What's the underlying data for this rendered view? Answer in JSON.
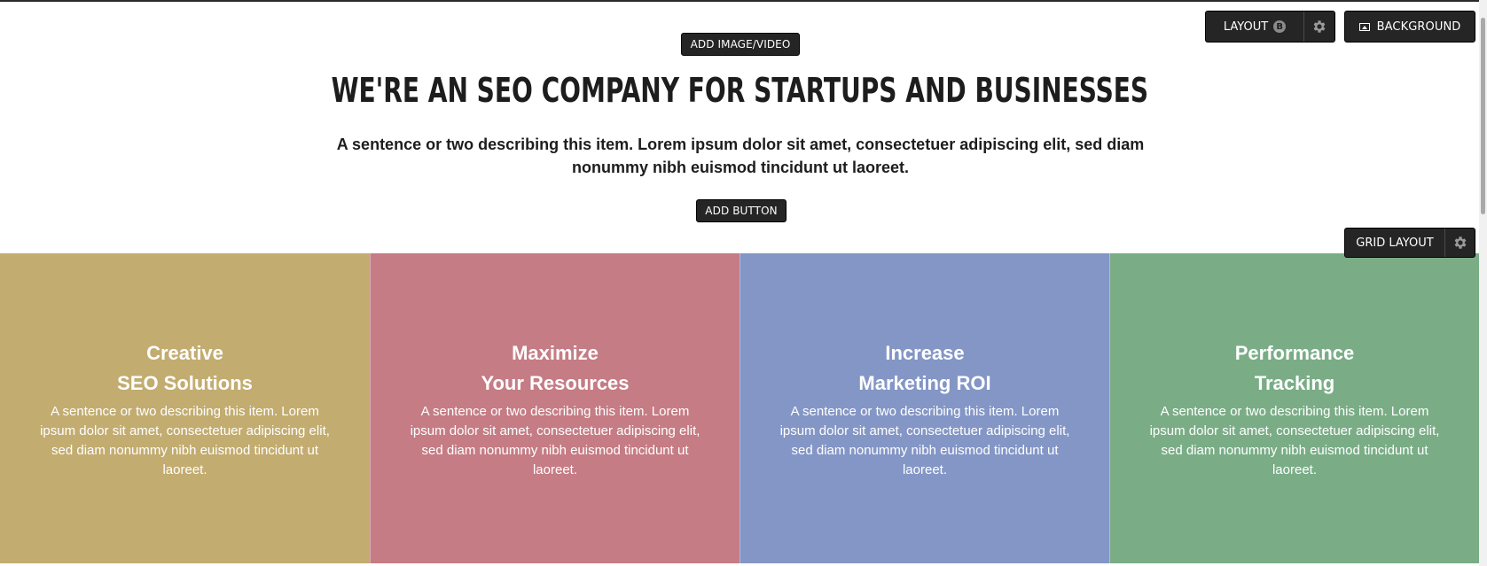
{
  "toolbar": {
    "add_media_label": "ADD IMAGE/VIDEO",
    "add_button_label": "ADD BUTTON",
    "layout_label": "LAYOUT",
    "layout_badge": "B",
    "background_label": "BACKGROUND",
    "grid_layout_label": "GRID LAYOUT"
  },
  "hero": {
    "title": "WE'RE AN SEO COMPANY FOR STARTUPS AND BUSINESSES",
    "subtitle": "A sentence or two describing this item. Lorem ipsum dolor sit amet, consectetuer adipiscing elit, sed diam nonummy nibh euismod tincidunt ut laoreet."
  },
  "features": [
    {
      "title_line1": "Creative",
      "title_line2": "SEO Solutions",
      "description": "A sentence or two describing this item. Lorem ipsum dolor sit amet, consectetuer adipiscing elit, sed diam nonummy nibh euismod tincidunt ut laoreet.",
      "color": "#c2ac70"
    },
    {
      "title_line1": "Maximize",
      "title_line2": "Your Resources",
      "description": "A sentence or two describing this item. Lorem ipsum dolor sit amet, consectetuer adipiscing elit, sed diam nonummy nibh euismod tincidunt ut laoreet.",
      "color": "#c57c84"
    },
    {
      "title_line1": "Increase",
      "title_line2": "Marketing ROI",
      "description": "A sentence or two describing this item. Lorem ipsum dolor sit amet, consectetuer adipiscing elit, sed diam nonummy nibh euismod tincidunt ut laoreet.",
      "color": "#8396c6"
    },
    {
      "title_line1": "Performance",
      "title_line2": "Tracking",
      "description": "A sentence or two describing this item. Lorem ipsum dolor sit amet, consectetuer adipiscing elit, sed diam nonummy nibh euismod tincidunt ut laoreet.",
      "color": "#7aad86"
    }
  ],
  "icons": {
    "layout_settings": "gear-icon",
    "background": "image-icon",
    "grid_settings": "gear-icon"
  }
}
